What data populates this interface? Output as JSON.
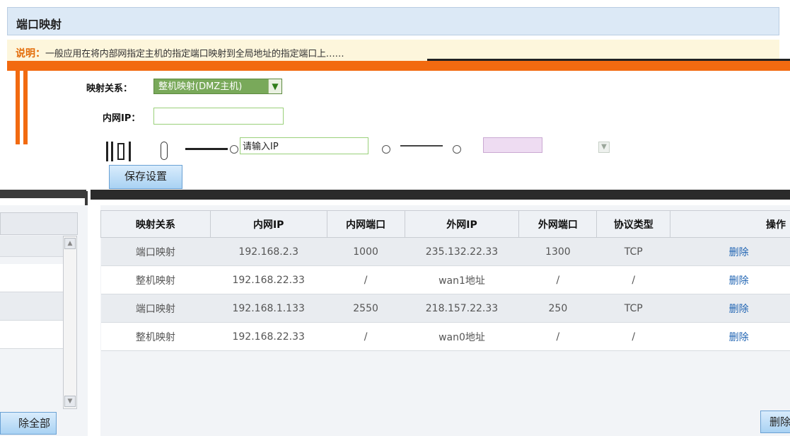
{
  "header": {
    "title": "端口映射"
  },
  "notice": {
    "label": "说明：",
    "text": "一般应用在将内部网指定主机的指定端口映射到全局地址的指定端口上……"
  },
  "form": {
    "mapping_label": "映射关系：",
    "mapping_value": "整机映射(DMZ主机)",
    "lan_ip_label": "内网IP：",
    "lan_ip_value": "",
    "garbled_row_a": "",
    "garbled_row_b": "请输入IP",
    "garbled_row_c": "",
    "save_button": "保存设置"
  },
  "left_panel": {
    "bottom_button": "除全部"
  },
  "table": {
    "headers": [
      "映射关系",
      "内网IP",
      "内网端口",
      "外网IP",
      "外网端口",
      "协议类型",
      "操作"
    ],
    "rows": [
      [
        "端口映射",
        "192.168.2.3",
        "1000",
        "235.132.22.33",
        "1300",
        "TCP",
        "删除"
      ],
      [
        "整机映射",
        "192.168.22.33",
        "/",
        "wan1地址",
        "/",
        "/",
        "删除"
      ],
      [
        "端口映射",
        "192.168.1.133",
        "2550",
        "218.157.22.33",
        "250",
        "TCP",
        "删除"
      ],
      [
        "整机映射",
        "192.168.22.33",
        "/",
        "wan0地址",
        "/",
        "/",
        "删除"
      ]
    ],
    "delete_all_button": "删除"
  },
  "colors": {
    "accent_orange": "#f26a10",
    "header_blue": "#dce9f6",
    "link_blue": "#2165b3"
  }
}
